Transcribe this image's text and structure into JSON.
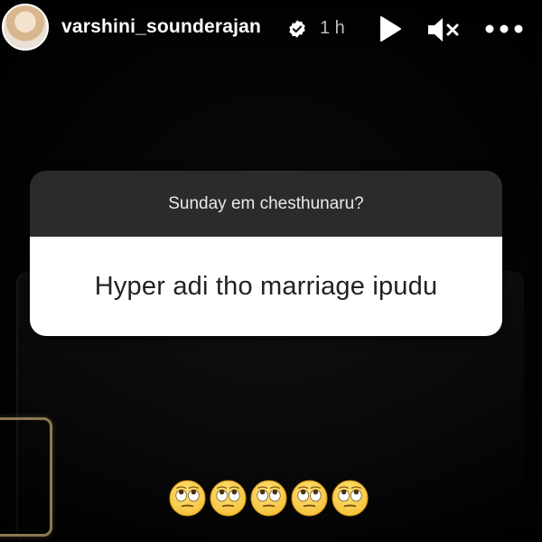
{
  "header": {
    "username": "varshini_sounderajan",
    "time": "1 h",
    "verified_icon": "verified-badge-icon",
    "play_icon": "play-icon",
    "mute_icon": "muted-speaker-icon",
    "more_icon": "more-horizontal-icon"
  },
  "question": {
    "prompt": "Sunday em chesthunaru?",
    "answer": "Hyper adi tho marriage ipudu"
  },
  "emojis": {
    "icon": "eye-roll-emoji",
    "count": 5
  },
  "colors": {
    "background": "#000000",
    "sticker_top": "#2b2b2b",
    "sticker_answer": "#ffffff",
    "emoji_face": "#f4c23a"
  }
}
